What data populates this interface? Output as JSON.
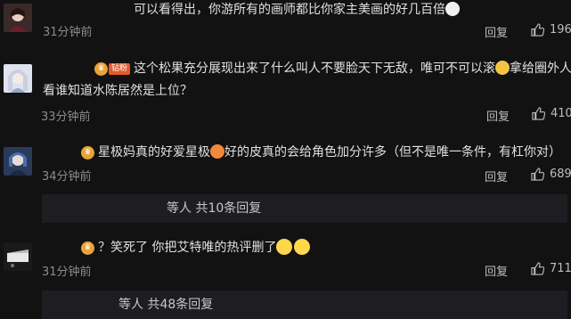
{
  "comments": [
    {
      "text": "可以看得出，你游所有的画师都比你家主美画的好几百倍",
      "time": "31分钟前",
      "reply_label": "回复",
      "likes": "196"
    },
    {
      "badge": "钻粉",
      "text": "这个松果充分展现出来了什么叫人不要脸天下无敌，唯可不可以滚",
      "text_after_emoji": "拿给圈外人",
      "text_line2": "看谁知道水陈居然是上位？",
      "time": "33分钟前",
      "reply_label": "回复",
      "likes": "410"
    },
    {
      "text_before_emoji": "星极妈真的好爱星极",
      "text_after_emoji": "好的皮真的会给角色加分许多（但不是唯一条件，有杠你对）",
      "time": "34分钟前",
      "reply_label": "回复",
      "likes": "689",
      "replies_summary": "等人 共10条回复"
    },
    {
      "text": "？笑死了 你把艾特唯的热评删了",
      "time": "31分钟前",
      "reply_label": "回复",
      "likes": "711",
      "replies_summary": "等人 共48条回复"
    }
  ],
  "icons": {
    "like": "thumbs-up-icon",
    "fan_badge": "crown-icon"
  },
  "colors": {
    "background": "#121212",
    "reply_box": "#1e1e22",
    "badge_orange": "#e25a2c",
    "crown_gold": "#e8a33a"
  }
}
